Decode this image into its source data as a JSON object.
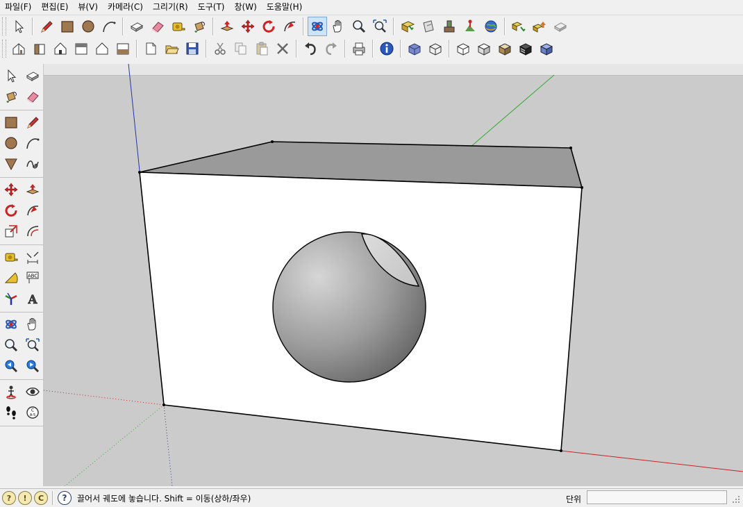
{
  "menu": [
    "파일(F)",
    "편집(E)",
    "뷰(V)",
    "카메라(C)",
    "그리기(R)",
    "도구(T)",
    "창(W)",
    "도움말(H)"
  ],
  "toolbar_row1": [
    {
      "name": "select",
      "icon": "select"
    },
    {
      "sep": true
    },
    {
      "name": "line",
      "icon": "pencil"
    },
    {
      "name": "rectangle",
      "icon": "rect"
    },
    {
      "name": "circle",
      "icon": "circle"
    },
    {
      "name": "arc",
      "icon": "arc"
    },
    {
      "sep": true
    },
    {
      "name": "make-component",
      "icon": "component"
    },
    {
      "name": "eraser",
      "icon": "eraser"
    },
    {
      "name": "tape-measure",
      "icon": "tape"
    },
    {
      "name": "paint-bucket",
      "icon": "bucket"
    },
    {
      "sep": true
    },
    {
      "name": "push-pull",
      "icon": "pushpull"
    },
    {
      "name": "move",
      "icon": "move"
    },
    {
      "name": "rotate",
      "icon": "rotate"
    },
    {
      "name": "follow-me",
      "icon": "followme"
    },
    {
      "sep": true
    },
    {
      "name": "orbit",
      "icon": "orbit",
      "active": true
    },
    {
      "name": "pan",
      "icon": "hand"
    },
    {
      "name": "zoom",
      "icon": "zoom"
    },
    {
      "name": "zoom-extents",
      "icon": "zoomext"
    },
    {
      "sep": true
    },
    {
      "name": "get-models",
      "icon": "getmodels"
    },
    {
      "name": "share-model",
      "icon": "share"
    },
    {
      "name": "get-photo-texture",
      "icon": "phototex"
    },
    {
      "name": "add-location",
      "icon": "location"
    },
    {
      "name": "google-earth",
      "icon": "earth"
    },
    {
      "sep": true
    },
    {
      "name": "component-get",
      "icon": "compget"
    },
    {
      "name": "component-share",
      "icon": "compshare"
    },
    {
      "name": "extension",
      "icon": "extension"
    }
  ],
  "toolbar_row2": [
    {
      "name": "iso-view",
      "icon": "house-iso"
    },
    {
      "name": "front-view",
      "icon": "house-side"
    },
    {
      "name": "right-view",
      "icon": "house-front"
    },
    {
      "name": "back-view",
      "icon": "house-back"
    },
    {
      "name": "left-view",
      "icon": "house-left"
    },
    {
      "name": "top-view",
      "icon": "house-top"
    },
    {
      "sep": true
    },
    {
      "name": "new",
      "icon": "new"
    },
    {
      "name": "open",
      "icon": "open"
    },
    {
      "name": "save",
      "icon": "save"
    },
    {
      "sep": true
    },
    {
      "name": "cut",
      "icon": "cut"
    },
    {
      "name": "copy",
      "icon": "copy"
    },
    {
      "name": "paste",
      "icon": "paste"
    },
    {
      "name": "delete",
      "icon": "delete"
    },
    {
      "sep": true
    },
    {
      "name": "undo",
      "icon": "undo"
    },
    {
      "name": "redo",
      "icon": "redo"
    },
    {
      "sep": true
    },
    {
      "name": "print",
      "icon": "print"
    },
    {
      "sep": true
    },
    {
      "name": "model-info",
      "icon": "info"
    },
    {
      "sep": true
    },
    {
      "name": "xray",
      "icon": "xray"
    },
    {
      "name": "wireframe",
      "icon": "wire"
    },
    {
      "sep": true
    },
    {
      "name": "hidden-line",
      "icon": "hidden"
    },
    {
      "name": "shaded",
      "icon": "shaded"
    },
    {
      "name": "shaded-textures",
      "icon": "textured"
    },
    {
      "name": "monochrome",
      "icon": "mono"
    },
    {
      "name": "shaded-blue",
      "icon": "shadedblue"
    }
  ],
  "left_toolbar": [
    [
      {
        "name": "select",
        "icon": "select"
      },
      {
        "name": "make-component",
        "icon": "component"
      },
      {
        "name": "paint-bucket",
        "icon": "bucket"
      },
      {
        "name": "eraser",
        "icon": "eraser"
      }
    ],
    [
      {
        "name": "rectangle",
        "icon": "rect"
      },
      {
        "name": "line",
        "icon": "pencil"
      },
      {
        "name": "circle",
        "icon": "circle"
      },
      {
        "name": "arc",
        "icon": "arc"
      },
      {
        "name": "polygon",
        "icon": "polygon"
      },
      {
        "name": "freehand",
        "icon": "freehand"
      }
    ],
    [
      {
        "name": "move",
        "icon": "move"
      },
      {
        "name": "push-pull",
        "icon": "pushpull"
      },
      {
        "name": "rotate",
        "icon": "rotate"
      },
      {
        "name": "follow-me",
        "icon": "followme"
      },
      {
        "name": "scale",
        "icon": "scale"
      },
      {
        "name": "offset",
        "icon": "offset"
      }
    ],
    [
      {
        "name": "tape-measure",
        "icon": "tape"
      },
      {
        "name": "dimension",
        "icon": "dimension"
      },
      {
        "name": "protractor",
        "icon": "protractor"
      },
      {
        "name": "text",
        "icon": "text-abc"
      },
      {
        "name": "axes",
        "icon": "axes"
      },
      {
        "name": "3d-text",
        "icon": "text3d"
      }
    ],
    [
      {
        "name": "orbit",
        "icon": "orbit"
      },
      {
        "name": "pan",
        "icon": "hand"
      },
      {
        "name": "zoom",
        "icon": "zoom"
      },
      {
        "name": "zoom-extents",
        "icon": "zoomext"
      },
      {
        "name": "previous-view",
        "icon": "prevview"
      },
      {
        "name": "next-view",
        "icon": "nextview"
      }
    ],
    [
      {
        "name": "position-camera",
        "icon": "camera-pos"
      },
      {
        "name": "look-around",
        "icon": "eye"
      },
      {
        "name": "walk",
        "icon": "walk"
      },
      {
        "name": "section-plane",
        "icon": "section"
      }
    ]
  ],
  "status": {
    "help_text": "끌어서 궤도에 놓습니다.  Shift = 이동(상하/좌우)",
    "units_label": "단위",
    "units_value": ""
  },
  "colors": {
    "axis_red": "#cc2222",
    "axis_green": "#33aa33",
    "axis_blue": "#2233aa",
    "background": "#cbcbcb",
    "face_top": "#9a9a9a"
  }
}
